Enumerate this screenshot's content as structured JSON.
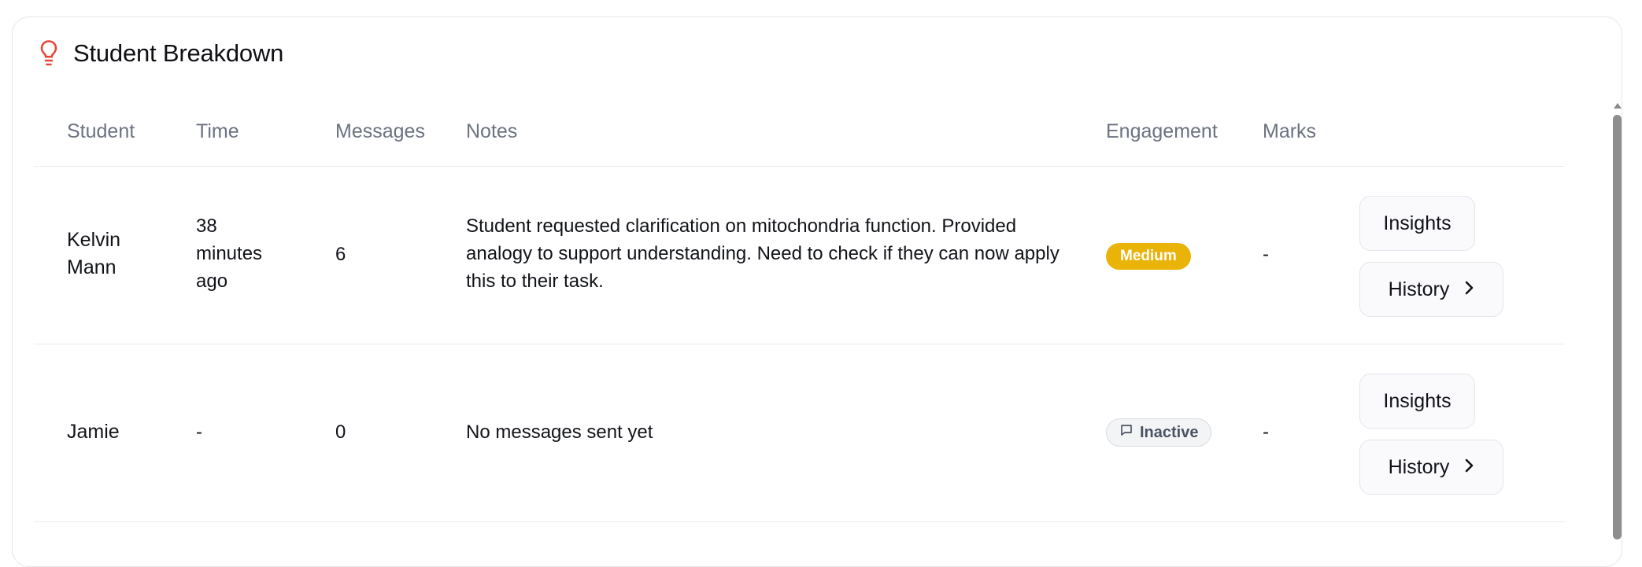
{
  "card": {
    "title": "Student Breakdown",
    "icon": "lightbulb-icon",
    "icon_color": "#e5483b"
  },
  "table": {
    "headers": {
      "student": "Student",
      "time": "Time",
      "messages": "Messages",
      "notes": "Notes",
      "engagement": "Engagement",
      "marks": "Marks"
    },
    "rows": [
      {
        "student_line1": "Kelvin",
        "student_line2": "Mann",
        "time_line1": "38",
        "time_line2": "minutes",
        "time_line3": "ago",
        "messages": "6",
        "notes": "Student requested clarification on mitochondria function. Provided analogy to support understanding. Need to check if they can now apply this to their task.",
        "engagement": "Medium",
        "engagement_color": "#eab308",
        "marks": "-",
        "insights_label": "Insights",
        "history_label": "History"
      },
      {
        "student_line1": "Jamie",
        "time_line1": "-",
        "messages": "0",
        "notes": "No messages sent yet",
        "engagement": "Inactive",
        "engagement_icon": "message-square-icon",
        "marks": "-",
        "insights_label": "Insights",
        "history_label": "History"
      }
    ]
  }
}
